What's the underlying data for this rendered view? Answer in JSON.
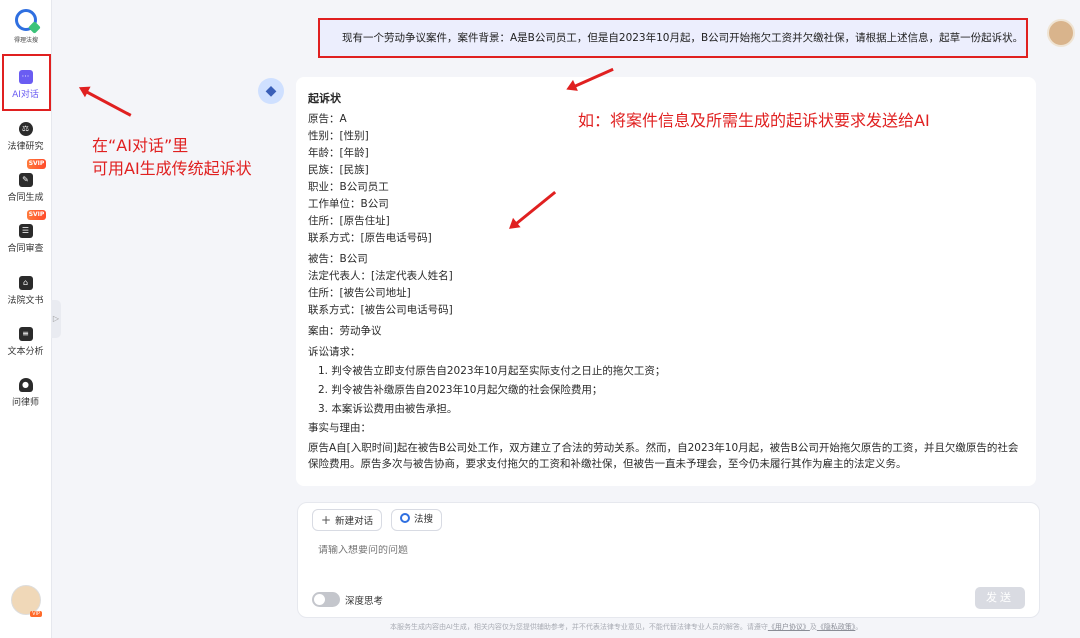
{
  "logo": {
    "text": "得理法搜"
  },
  "nav": [
    {
      "label": "AI对话",
      "icon": "chat-icon",
      "active": true
    },
    {
      "label": "法律研究",
      "icon": "research-icon"
    },
    {
      "label": "合同生成",
      "icon": "contract-gen-icon",
      "badge": "SVIP"
    },
    {
      "label": "合同审查",
      "icon": "contract-review-icon",
      "badge": "SVIP"
    },
    {
      "label": "法院文书",
      "icon": "court-doc-icon"
    },
    {
      "label": "文本分析",
      "icon": "text-analysis-icon"
    },
    {
      "label": "问律师",
      "icon": "lawyer-icon"
    }
  ],
  "chat": {
    "user_message": "现有一个劳动争议案件，案件背景：A是B公司员工，但是自2023年10月起，B公司开始拖欠工资并欠缴社保，请根据上述信息，起草一份起诉状。",
    "answer": {
      "title": "起诉状",
      "plaintiff": [
        "原告：A",
        "性别：[性别]",
        "年龄：[年龄]",
        "民族：[民族]",
        "职业：B公司员工",
        "工作单位：B公司",
        "住所：[原告住址]",
        "联系方式：[原告电话号码]"
      ],
      "defendant": [
        "被告：B公司",
        "法定代表人：[法定代表人姓名]",
        "住所：[被告公司地址]",
        "联系方式：[被告公司电话号码]"
      ],
      "cause": "案由：劳动争议",
      "claims_heading": "诉讼请求：",
      "claims": [
        "1. 判令被告立即支付原告自2023年10月起至实际支付之日止的拖欠工资；",
        "2. 判令被告补缴原告自2023年10月起欠缴的社会保险费用；",
        "3. 本案诉讼费用由被告承担。"
      ],
      "facts_heading": "事实与理由：",
      "facts": "原告A自[入职时间]起在被告B公司处工作，双方建立了合法的劳动关系。然而，自2023年10月起，被告B公司开始拖欠原告的工资，并且欠缴原告的社会保险费用。原告多次与被告协商，要求支付拖欠的工资和补缴社保，但被告一直未予理会，至今仍未履行其作为雇主的法定义务。"
    }
  },
  "annotations": {
    "left_line1": "在“AI对话”里",
    "left_line2": "可用AI生成传统起诉状",
    "right": "如：将案件信息及所需生成的起诉状要求发送给AI"
  },
  "input": {
    "new_chat_label": "新建对话",
    "fasou_label": "法搜",
    "placeholder": "请输入想要问的问题",
    "deep_think_label": "深度思考",
    "deep_think_on": false,
    "send_label": "发送"
  },
  "footer": {
    "text": "本服务生成内容由AI生成，相关内容仅为您提供辅助参考，并不代表法律专业意见，不能代替法律专业人员的解答。请遵守",
    "agreement": "《用户协议》",
    "and": "及",
    "privacy": "《隐私政策》",
    "end": "。"
  },
  "colors": {
    "accent": "#6a5cf2",
    "annotation": "#e02020",
    "bubble": "#eceefd"
  }
}
